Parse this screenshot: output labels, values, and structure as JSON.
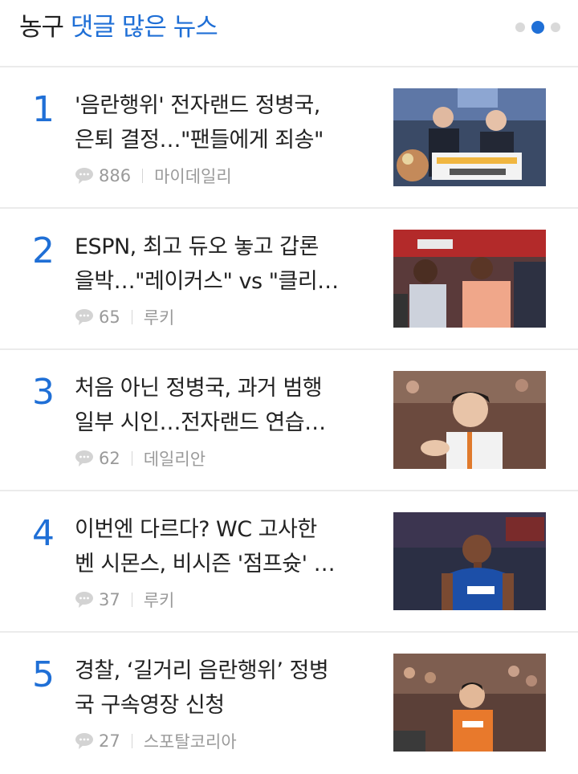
{
  "header": {
    "title_prefix": "농구",
    "title_accent": "댓글 많은 뉴스",
    "pager_total": 3,
    "pager_active": 2
  },
  "news": [
    {
      "rank": "1",
      "headline_line1": "'음란행위' 전자랜드 정병국,",
      "headline_line2": "은퇴 결정…\"팬들에게 죄송\"",
      "comments": "886",
      "source": "마이데일리",
      "thumb_icon": "award-ceremony-photo"
    },
    {
      "rank": "2",
      "headline_line1": "ESPN, 최고 듀오 놓고 갑론",
      "headline_line2": "을박…\"레이커스\" vs \"클리…",
      "comments": "65",
      "source": "루키",
      "thumb_icon": "courtside-players-photo"
    },
    {
      "rank": "3",
      "headline_line1": "처음 아닌 정병국, 과거 범행",
      "headline_line2": "일부 시인…전자랜드 연습…",
      "comments": "62",
      "source": "데일리안",
      "thumb_icon": "player-clapping-photo"
    },
    {
      "rank": "4",
      "headline_line1": "이번엔 다르다? WC 고사한",
      "headline_line2": "벤 시몬스, 비시즌 '점프슛' …",
      "comments": "37",
      "source": "루키",
      "thumb_icon": "basketball-player-photo"
    },
    {
      "rank": "5",
      "headline_line1": "경찰, ‘길거리 음란행위’ 정병",
      "headline_line2": "국 구속영장 신청",
      "comments": "27",
      "source": "스포탈코리아",
      "thumb_icon": "game-action-photo"
    }
  ],
  "colors": {
    "accent": "#1f6fd6",
    "text": "#222222",
    "meta": "#999999",
    "divider": "#ebebeb"
  }
}
